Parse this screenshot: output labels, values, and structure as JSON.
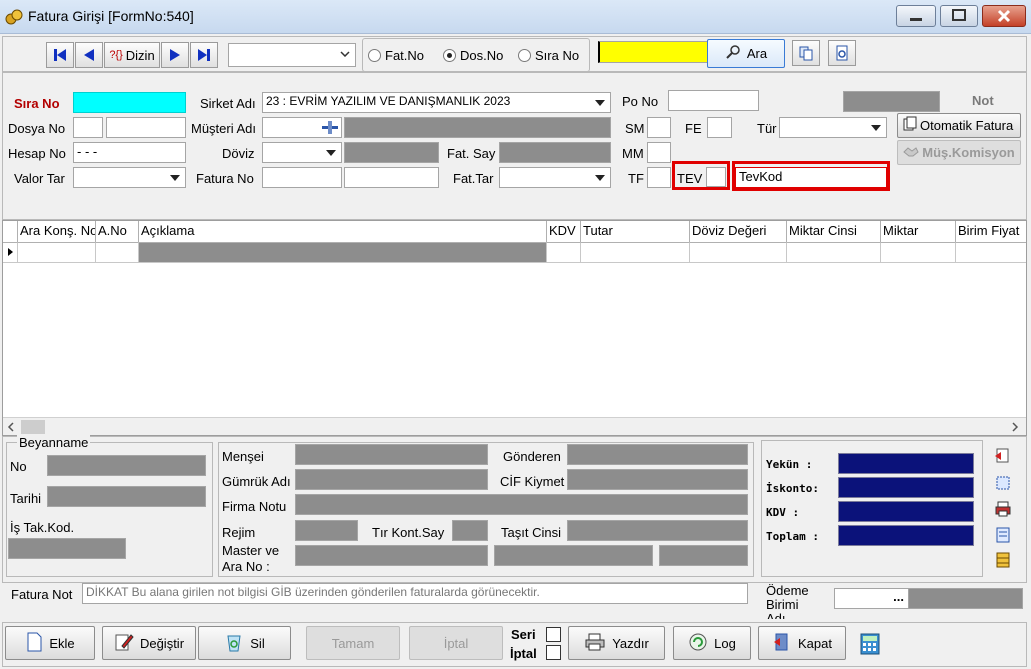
{
  "window": {
    "title": "Fatura Girişi [FormNo:540]"
  },
  "toolbar": {
    "dizin_label": "Dizin",
    "dizin_prefix": "?{}",
    "search_mode_options": [
      {
        "label": "Fat.No",
        "selected": false
      },
      {
        "label": "Dos.No",
        "selected": true
      },
      {
        "label": "Sıra No",
        "selected": false
      }
    ],
    "search_button_label": "Ara",
    "search_value": ""
  },
  "header_form": {
    "sira_no_label": "Sıra No",
    "sira_no_value": "",
    "sirket_adi_label": "Sirket Adı",
    "sirket_adi_value": "23 : EVRİM YAZILIM  VE DANIŞMANLIK 2023",
    "po_no_label": "Po No",
    "not_label": "Not",
    "dosya_no_label": "Dosya No",
    "musteri_adi_label": "Müşteri Adı",
    "sm_label": "SM",
    "fe_label": "FE",
    "tur_label": "Tür",
    "otomatik_fatura_label": "Otomatik Fatura",
    "mus_komisyon_label": "Müş.Komisyon",
    "hesap_no_label": "Hesap No",
    "hesap_no_value": " -  -  -",
    "doviz_label": "Döviz",
    "fat_say_label": "Fat. Say",
    "mm_label": "MM",
    "valor_tar_label": "Valor Tar",
    "fatura_no_label": "Fatura No",
    "fat_tar_label": "Fat.Tar",
    "tf_label": "TF",
    "tev_label": "TEV",
    "tevkod_value": "TevKod"
  },
  "grid": {
    "columns": [
      "Ara Konş. No",
      "A.No",
      "Açıklama",
      "KDV",
      "Tutar",
      "Döviz Değeri",
      "Miktar Cinsi",
      "Miktar",
      "Birim Fiyat"
    ]
  },
  "beyanname": {
    "group_label": "Beyanname",
    "no_label": "No",
    "tarihi_label": "Tarihi",
    "is_tak_kod_label": "İş Tak.Kod."
  },
  "details": {
    "mensei_label": "Menşei",
    "gonderen_label": "Gönderen",
    "gumruk_adi_label": "Gümrük Adı",
    "cif_kiymet_label": "CİF Kiymet",
    "firma_notu_label": "Firma Notu",
    "rejim_label": "Rejim",
    "tir_kont_say_label": "Tır Kont.Say",
    "tasit_cinsi_label": "Taşıt Cinsi",
    "master_ve_label": "Master ve",
    "ara_no_label": "Ara No :"
  },
  "totals": {
    "yekun_label": "Yekün  :",
    "iskonto_label": "İskonto:",
    "kdv_label": "KDV    :",
    "toplam_label": "Toplam :"
  },
  "footer": {
    "fatura_not_label": "Fatura Not",
    "fatura_not_placeholder": "DİKKAT Bu alana girilen not bilgisi GİB üzerinden gönderilen faturalarda görünecektir.",
    "odeme_birimi_label_1": "Ödeme",
    "odeme_birimi_label_2": "Birimi",
    "odeme_birimi_label_3": "Adı",
    "odeme_ellipsis": "..."
  },
  "actions": {
    "ekle": "Ekle",
    "degistir": "Değiştir",
    "sil": "Sil",
    "tamam": "Tamam",
    "iptal_button": "İptal",
    "seri_label": "Seri",
    "iptal_check_label": "İptal",
    "yazdir": "Yazdır",
    "log": "Log",
    "kapat": "Kapat"
  },
  "colors": {
    "sira_no_label": "#b30000",
    "sira_no_field": "#00ffff",
    "search_field": "#ffff00",
    "highlight_box": "#e00000",
    "totals_fill": "#0b127a",
    "disabled_fill": "#8d8d8d"
  }
}
